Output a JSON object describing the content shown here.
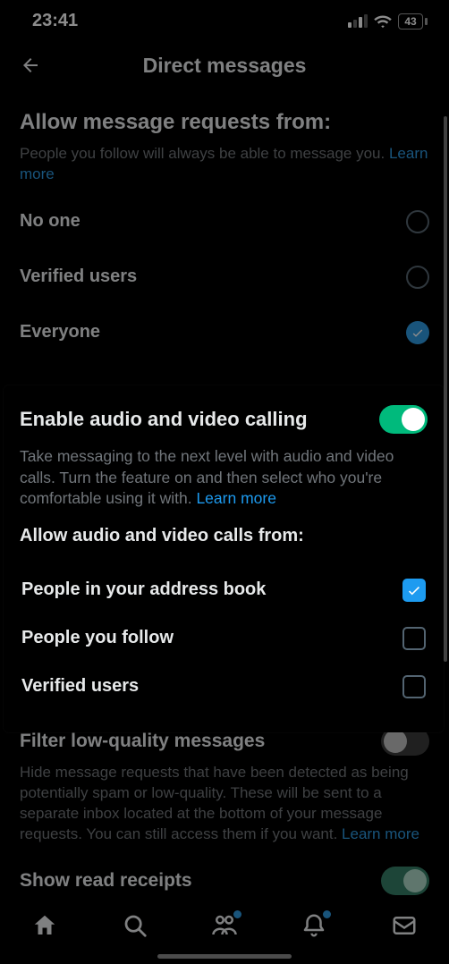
{
  "status": {
    "time": "23:41",
    "battery": "43"
  },
  "nav": {
    "title": "Direct messages"
  },
  "requests": {
    "heading": "Allow message requests from:",
    "desc": "People you follow will always be able to message you. ",
    "learn": "Learn more",
    "options": {
      "none": "No one",
      "verified": "Verified users",
      "everyone": "Everyone"
    }
  },
  "calling": {
    "title": "Enable audio and video calling",
    "desc": "Take messaging to the next level with audio and video calls. Turn the feature on and then select who you're comfortable using it with. ",
    "learn": "Learn more",
    "sub": "Allow audio and video calls from:",
    "opts": {
      "addressbook": "People in your address book",
      "follow": "People you follow",
      "verified": "Verified users"
    }
  },
  "filter": {
    "title": "Filter low-quality messages",
    "desc": "Hide message requests that have been detected as being potentially spam or low-quality. These will be sent to a separate inbox located at the bottom of your message requests. You can still access them if you want. ",
    "learn": "Learn more"
  },
  "receipts": {
    "title": "Show read receipts"
  }
}
